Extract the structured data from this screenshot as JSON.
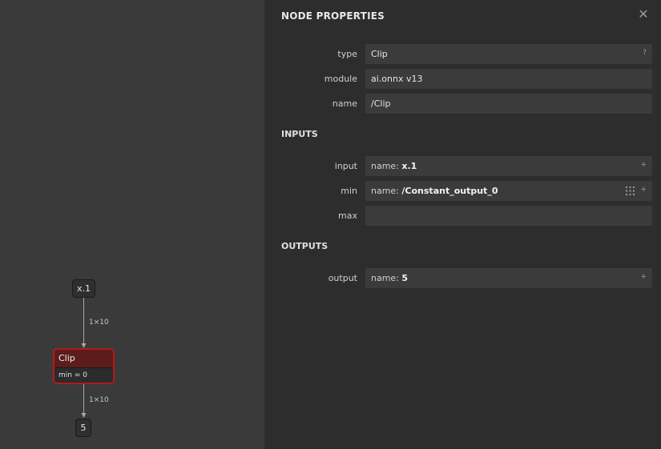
{
  "graph": {
    "input_node": "x.1",
    "edge_in_label": "1×10",
    "op_node": {
      "title": "Clip",
      "attr": "min = 0"
    },
    "edge_out_label": "1×10",
    "output_node": "5"
  },
  "panel": {
    "title": "NODE PROPERTIES",
    "close_glyph": "✕",
    "properties": {
      "type_label": "type",
      "type_value": "Clip",
      "type_help": "?",
      "module_label": "module",
      "module_value": "ai.onnx v13",
      "name_label": "name",
      "name_value": "/Clip"
    },
    "inputs": {
      "title": "INPUTS",
      "items": [
        {
          "label": "input",
          "prefix": "name: ",
          "value": "x.1",
          "expand": "+"
        },
        {
          "label": "min",
          "prefix": "name: ",
          "value": "/Constant_output_0",
          "expand": "+"
        },
        {
          "label": "max",
          "prefix": "",
          "value": "",
          "expand": ""
        }
      ]
    },
    "outputs": {
      "title": "OUTPUTS",
      "items": [
        {
          "label": "output",
          "prefix": "name: ",
          "value": "5",
          "expand": "+"
        }
      ]
    }
  }
}
